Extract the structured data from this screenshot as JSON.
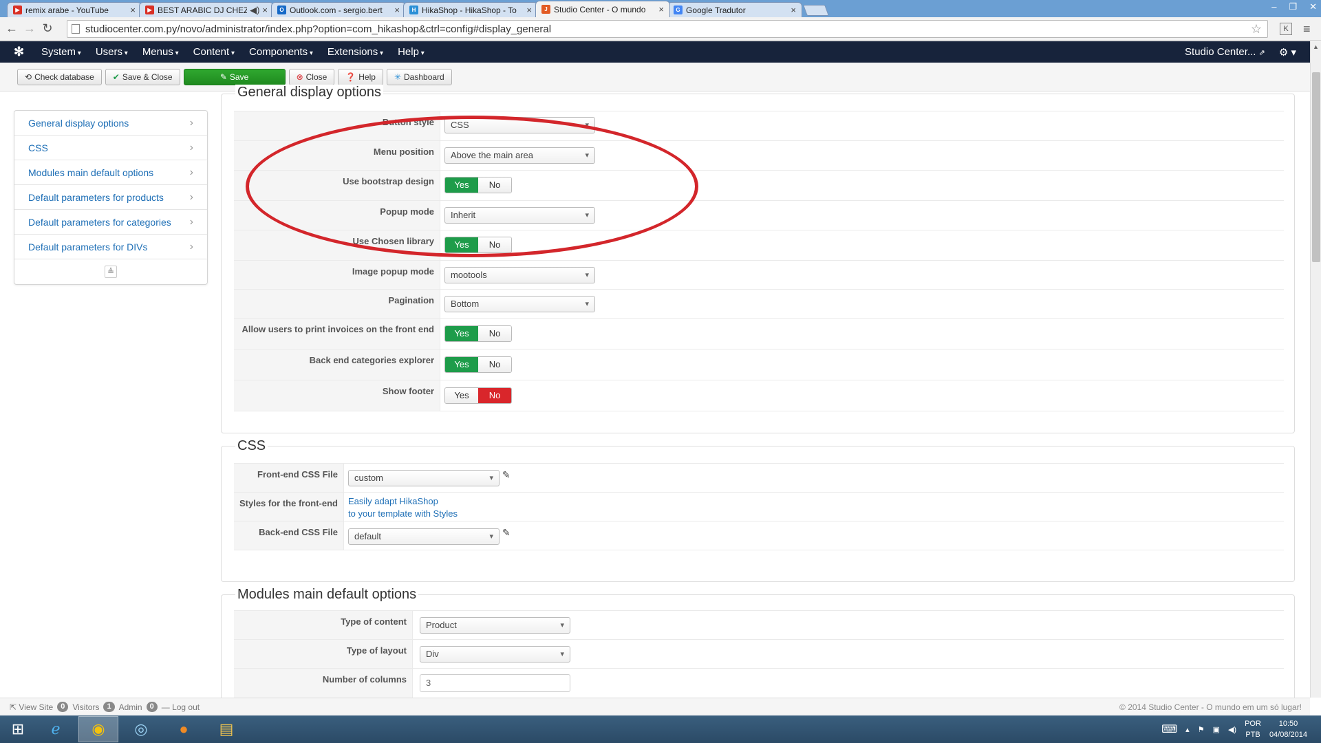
{
  "browser": {
    "tabs": [
      {
        "title": "remix arabe - YouTube",
        "icon": "youtube-icon",
        "color": "#d93025"
      },
      {
        "title": "BEST ARABIC DJ CHEZ",
        "icon": "youtube-icon",
        "color": "#d93025"
      },
      {
        "title": "Outlook.com - sergio.bert",
        "icon": "outlook-icon",
        "color": "#1569c7"
      },
      {
        "title": "HikaShop - HikaShop - To",
        "icon": "hikashop-icon",
        "color": "#2a8fd6"
      },
      {
        "title": "Studio Center - O mundo",
        "icon": "joomla-icon",
        "color": "#e25b24"
      },
      {
        "title": "Google Tradutor",
        "icon": "translate-icon",
        "color": "#4285f4"
      }
    ],
    "active_tab_index": 4,
    "url": "studiocenter.com.py/novo/administrator/index.php?option=com_hikashop&ctrl=config#display_general",
    "extension_label": "K"
  },
  "admin_nav": {
    "menus": [
      "System",
      "Users",
      "Menus",
      "Content",
      "Components",
      "Extensions",
      "Help"
    ],
    "site_link": "Studio Center..."
  },
  "toolbar": {
    "check_db": "Check database",
    "save_close": "Save & Close",
    "save": "Save",
    "close": "Close",
    "help": "Help",
    "dashboard": "Dashboard"
  },
  "sidebar": {
    "items": [
      "General display options",
      "CSS",
      "Modules main default options",
      "Default parameters for products",
      "Default parameters for categories",
      "Default parameters for DIVs"
    ]
  },
  "general": {
    "legend": "General display options",
    "button_style_label": "Button style",
    "button_style_value": "CSS",
    "menu_position_label": "Menu position",
    "menu_position_value": "Above the main area",
    "bootstrap_label": "Use bootstrap design",
    "popup_mode_label": "Popup mode",
    "popup_mode_value": "Inherit",
    "chosen_label": "Use Chosen library",
    "image_popup_label": "Image popup mode",
    "image_popup_value": "mootools",
    "pagination_label": "Pagination",
    "pagination_value": "Bottom",
    "print_invoices_label": "Allow users to print invoices on the front end",
    "categories_explorer_label": "Back end categories explorer",
    "show_footer_label": "Show footer",
    "yes": "Yes",
    "no": "No"
  },
  "css": {
    "legend": "CSS",
    "front_label": "Front-end CSS File",
    "front_value": "custom",
    "styles_label": "Styles for the front-end",
    "styles_link1": "Easily adapt HikaShop",
    "styles_link2": "to your template with Styles",
    "back_label": "Back-end CSS File",
    "back_value": "default"
  },
  "modules": {
    "legend": "Modules main default options",
    "content_type_label": "Type of content",
    "content_type_value": "Product",
    "layout_type_label": "Type of layout",
    "layout_type_value": "Div",
    "columns_label": "Number of columns",
    "columns_value": "3"
  },
  "status": {
    "view_site": "View Site",
    "visitors_count": "0",
    "visitors_label": "Visitors",
    "admin_count": "1",
    "admin_label": "Admin",
    "third_count": "0",
    "logout": "Log out",
    "copyright": "© 2014 Studio Center - O mundo em um só lugar!"
  },
  "taskbar": {
    "lang1": "POR",
    "lang2": "PTB",
    "time": "10:50",
    "date": "04/08/2014"
  },
  "colors": {
    "nav_bg": "#17233b",
    "save_green": "#1f8a1f",
    "yes_green": "#1e9c4a",
    "no_red": "#d9262b",
    "link_blue": "#1e6fb6",
    "annotation_red": "#d3262b"
  }
}
